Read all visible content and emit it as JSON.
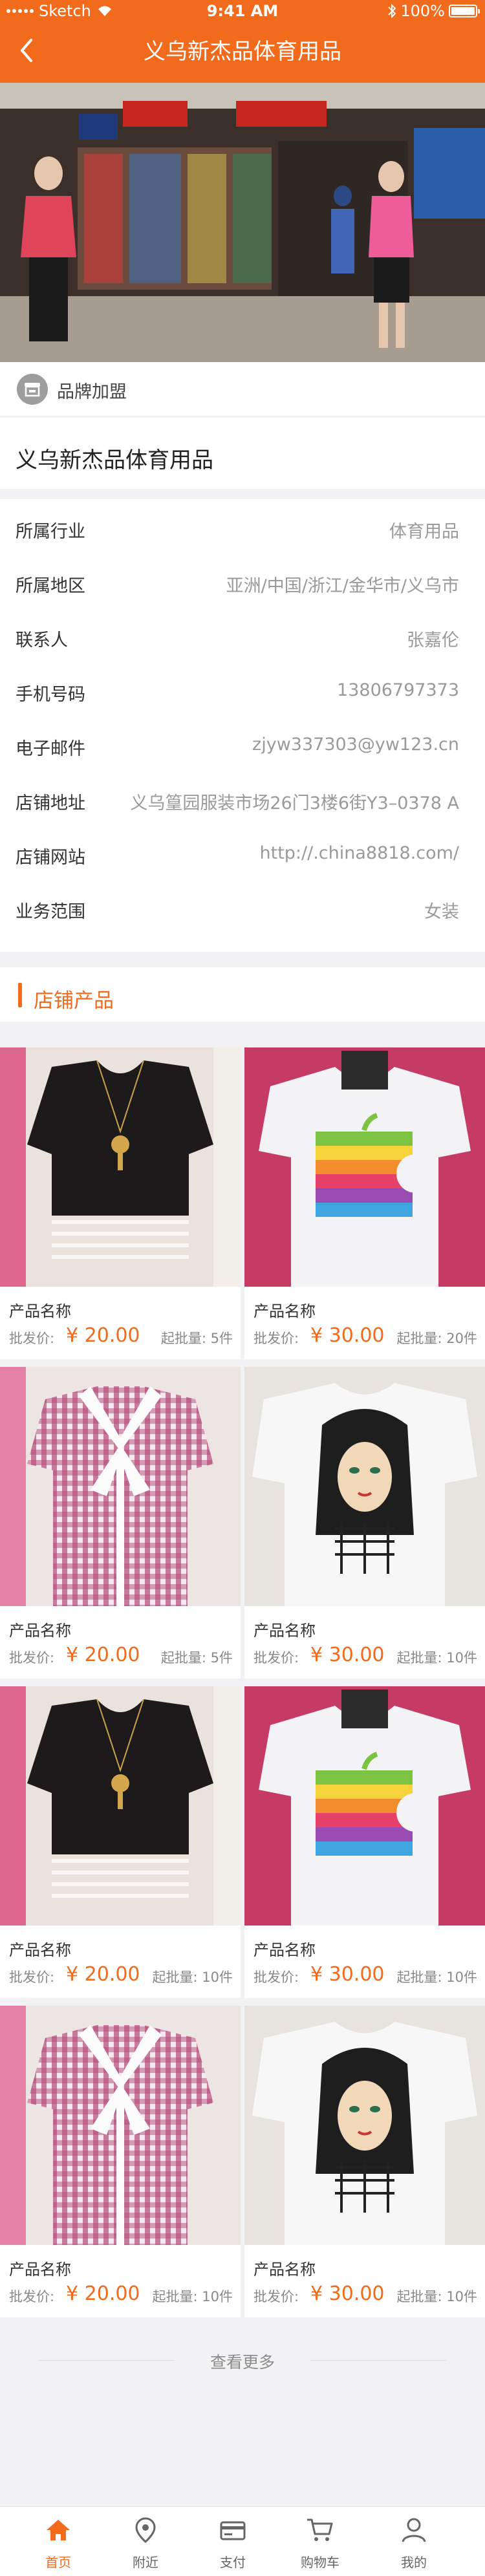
{
  "status_bar": {
    "carrier": "Sketch",
    "time": "9:41 AM",
    "battery": "100%"
  },
  "nav": {
    "title": "义乌新杰品体育用品"
  },
  "brand": {
    "label": "品牌加盟"
  },
  "store": {
    "name": "义乌新杰品体育用品"
  },
  "info": [
    {
      "label": "所属行业",
      "value": "体育用品"
    },
    {
      "label": "所属地区",
      "value": "亚洲/中国/浙江/金华市/义乌市"
    },
    {
      "label": "联系人",
      "value": "张嘉伦"
    },
    {
      "label": "手机号码",
      "value": "13806797373"
    },
    {
      "label": "电子邮件",
      "value": "zjyw337303@yw123.cn"
    },
    {
      "label": "店铺地址",
      "value": "义乌篁园服装市场26门3楼6街Y3–0378 A"
    },
    {
      "label": "店铺网站",
      "value": "http://.china8818.com/"
    },
    {
      "label": "业务范围",
      "value": "女装"
    }
  ],
  "section": {
    "title": "店铺产品"
  },
  "products": [
    {
      "name": "产品名称",
      "price_label": "批发价:",
      "price": "¥ 20.00",
      "moq": "起批量: 5件",
      "image": "black-top"
    },
    {
      "name": "产品名称",
      "price_label": "批发价:",
      "price": "¥ 30.00",
      "moq": "起批量: 20件",
      "image": "rainbow-apple-tee"
    },
    {
      "name": "产品名称",
      "price_label": "批发价:",
      "price": "¥ 20.00",
      "moq": "起批量: 5件",
      "image": "plaid-bow-blouse"
    },
    {
      "name": "产品名称",
      "price_label": "批发价:",
      "price": "¥ 30.00",
      "moq": "起批量: 10件",
      "image": "girl-print-tee"
    },
    {
      "name": "产品名称",
      "price_label": "批发价:",
      "price": "¥ 20.00",
      "moq": "起批量: 10件",
      "image": "black-top"
    },
    {
      "name": "产品名称",
      "price_label": "批发价:",
      "price": "¥ 30.00",
      "moq": "起批量: 10件",
      "image": "rainbow-apple-tee"
    },
    {
      "name": "产品名称",
      "price_label": "批发价:",
      "price": "¥ 20.00",
      "moq": "起批量: 10件",
      "image": "plaid-bow-blouse"
    },
    {
      "name": "产品名称",
      "price_label": "批发价:",
      "price": "¥ 30.00",
      "moq": "起批量: 10件",
      "image": "girl-print-tee"
    }
  ],
  "more": {
    "label": "查看更多"
  },
  "tabbar": [
    {
      "label": "首页",
      "icon": "home-icon",
      "active": true
    },
    {
      "label": "附近",
      "icon": "location-icon",
      "active": false
    },
    {
      "label": "支付",
      "icon": "card-icon",
      "active": false
    },
    {
      "label": "购物车",
      "icon": "cart-icon",
      "active": false
    },
    {
      "label": "我的",
      "icon": "user-icon",
      "active": false
    }
  ],
  "colors": {
    "accent": "#f26b1d",
    "background": "#f2f2f4"
  }
}
